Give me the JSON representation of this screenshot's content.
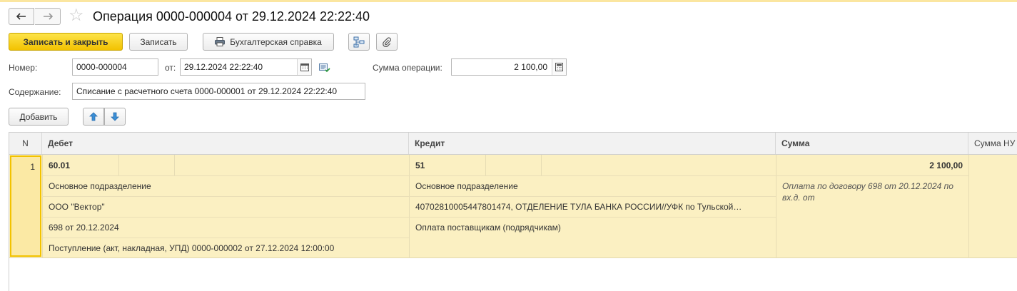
{
  "window": {
    "title": "Операция 0000-000004 от 29.12.2024 22:22:40",
    "back_icon": "arrow-left-icon",
    "forward_icon": "arrow-right-icon",
    "favorite_icon": "star-icon"
  },
  "toolbar": {
    "save_close_label": "Записать и закрыть",
    "save_label": "Записать",
    "report_label": "Бухгалтерская справка",
    "structure_icon": "structure-icon",
    "attach_icon": "paperclip-icon"
  },
  "form": {
    "number_label": "Номер:",
    "number_value": "0000-000004",
    "date_label": "от:",
    "date_value": "29.12.2024 22:22:40",
    "amount_label": "Сумма операции:",
    "amount_value": "2 100,00",
    "content_label": "Содержание:",
    "content_value": "Списание с расчетного счета 0000-000001 от 29.12.2024 22:22:40"
  },
  "table_toolbar": {
    "add_label": "Добавить",
    "up_icon": "arrow-up-icon",
    "down_icon": "arrow-down-icon"
  },
  "table": {
    "columns": {
      "n": "N",
      "debit": "Дебет",
      "credit": "Кредит",
      "sum": "Сумма",
      "sum_nu": "Сумма НУ"
    },
    "rows": [
      {
        "n": "1",
        "debit_account": "60.01",
        "debit_subconto": [
          "Основное подразделение",
          "ООО \"Вектор\"",
          "698 от 20.12.2024",
          "Поступление (акт, накладная, УПД) 0000-000002 от 27.12.2024 12:00:00"
        ],
        "credit_account": "51",
        "credit_subconto": [
          "Основное подразделение",
          "40702810005447801474, ОТДЕЛЕНИЕ ТУЛА БАНКА РОССИИ//УФК по Тульской…",
          "Оплата поставщикам (подрядчикам)"
        ],
        "amount": "2 100,00",
        "description": "Оплата по договору 698 от 20.12.2024 по вх.д.  от"
      }
    ]
  },
  "colors": {
    "accent_yellow": "#f2c200",
    "row_selected": "#fbf0c2"
  }
}
